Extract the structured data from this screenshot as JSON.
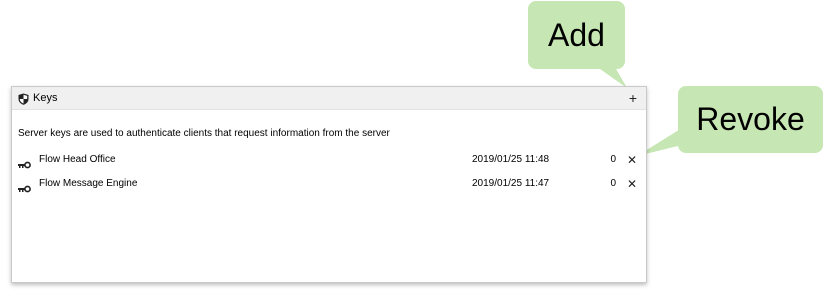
{
  "panel": {
    "title": "Keys",
    "icon": "shield-icon",
    "add_label": "+",
    "description": "Server keys are used to authenticate clients that request information from the server"
  },
  "keys": [
    {
      "name": "Flow Head Office",
      "date": "2019/01/25 11:48",
      "count": "0",
      "revoke_label": "✕",
      "icon": "key-icon"
    },
    {
      "name": "Flow Message Engine",
      "date": "2019/01/25 11:47",
      "count": "0",
      "revoke_label": "✕",
      "icon": "key-icon"
    }
  ],
  "callouts": {
    "add": "Add",
    "revoke": "Revoke",
    "color": "#c6e6b3"
  }
}
